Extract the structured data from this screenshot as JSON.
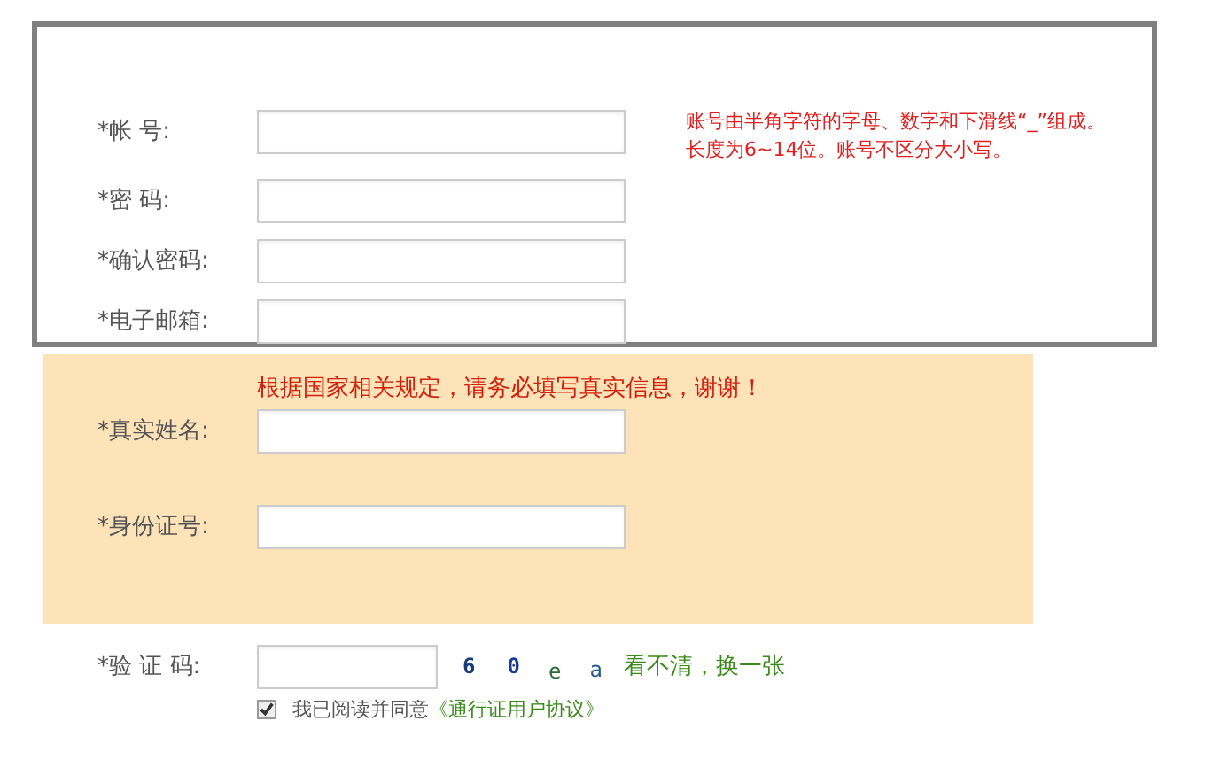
{
  "account_section": {
    "rows": [
      {
        "label": "*帐 号:"
      },
      {
        "label": "*密 码:"
      },
      {
        "label": "*确认密码:"
      },
      {
        "label": "*电子邮箱:"
      }
    ],
    "hint_lines": [
      "账号由半角字符的字母、数字和下滑线“_”组成。",
      "长度为6~14位。账号不区分大小写。"
    ]
  },
  "identity_section": {
    "notice": "根据国家相关规定，请务必填写真实信息，谢谢！",
    "rows": [
      {
        "label": "*真实姓名:"
      },
      {
        "label": "*身份证号:"
      }
    ]
  },
  "captcha": {
    "label": "*验 证 码:",
    "characters": [
      {
        "char": "6",
        "color": "#1a3a7a"
      },
      {
        "char": "0",
        "color": "#1a3a9a"
      },
      {
        "char": "e",
        "color": "#2a6a3a"
      },
      {
        "char": "a",
        "color": "#2a5a8a"
      }
    ],
    "refresh_link": "看不清，换一张"
  },
  "agreement": {
    "checked": true,
    "text": "我已阅读并同意",
    "link": "《通行证用户协议》"
  }
}
